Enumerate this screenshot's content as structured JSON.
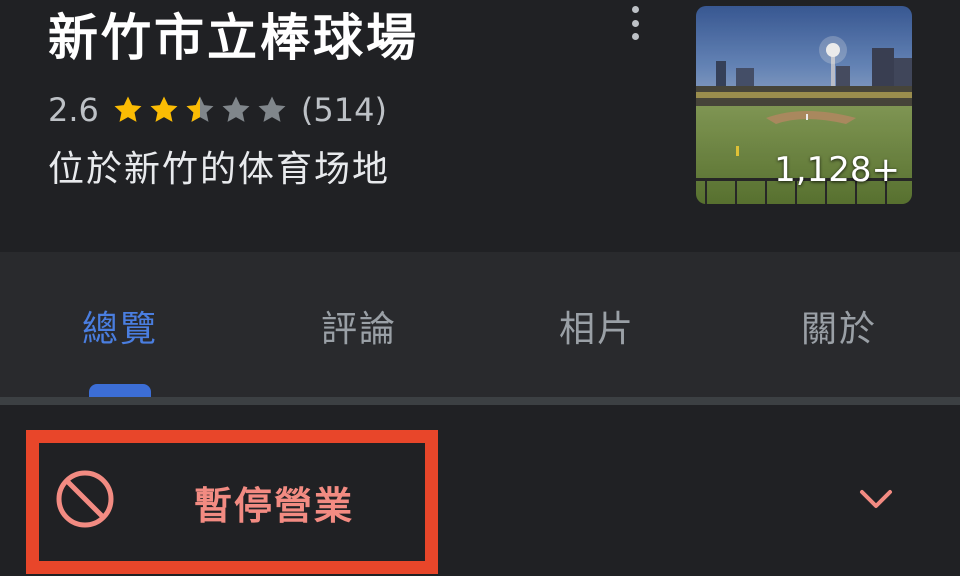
{
  "place": {
    "name": "新竹市立棒球場",
    "rating": "2.6",
    "rating_value": 2.6,
    "rating_max": 5,
    "review_count": "(514)",
    "category": "位於新竹的体育场地"
  },
  "photo": {
    "count_label": "1,128+"
  },
  "tabs": [
    {
      "label": "總覽",
      "active": true
    },
    {
      "label": "評論",
      "active": false
    },
    {
      "label": "相片",
      "active": false
    },
    {
      "label": "關於",
      "active": false
    }
  ],
  "status": {
    "label": "暫停營業"
  },
  "colors": {
    "background": "#202124",
    "tab_bar": "#292a2d",
    "accent_blue": "#4a7ee0",
    "star_gold": "#fbbc04",
    "highlight_red": "#e8462a",
    "closed_text": "#f28b82"
  },
  "icons": {
    "more": "more-vert-icon",
    "closed": "ban-icon",
    "expand": "chevron-down-icon"
  }
}
